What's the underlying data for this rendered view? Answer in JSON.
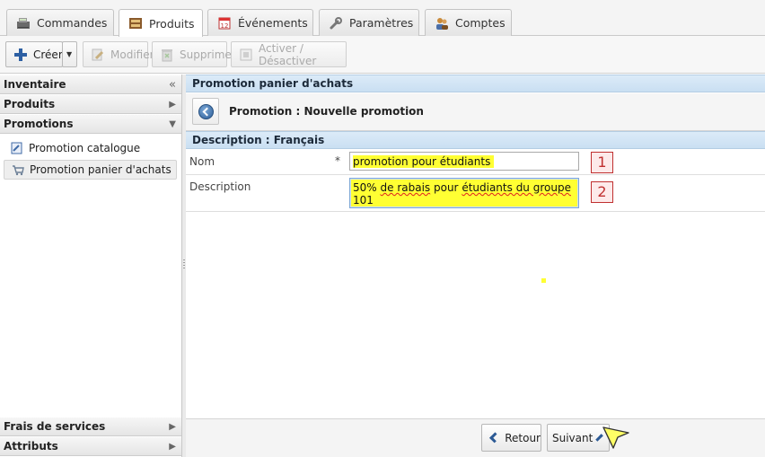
{
  "tabs": [
    {
      "label": "Commandes",
      "icon": "register-icon",
      "active": false
    },
    {
      "label": "Produits",
      "icon": "products-box-icon",
      "active": true
    },
    {
      "label": "Événements",
      "icon": "calendar-icon",
      "active": false
    },
    {
      "label": "Paramètres",
      "icon": "wrench-icon",
      "active": false
    },
    {
      "label": "Comptes",
      "icon": "users-icon",
      "active": false
    }
  ],
  "toolbar": {
    "create_label": "Créer",
    "edit_label": "Modifier",
    "delete_label": "Supprimer",
    "toggle_label": "Activer / Désactiver"
  },
  "sidebar": {
    "sections": [
      {
        "label": "Inventaire",
        "arrow": "«"
      },
      {
        "label": "Produits",
        "arrow": "▶"
      },
      {
        "label": "Promotions",
        "arrow": "▼"
      }
    ],
    "items": [
      {
        "label": "Promotion catalogue",
        "icon": "catalogue-promo-icon",
        "selected": false
      },
      {
        "label": "Promotion panier d'achats",
        "icon": "cart-promo-icon",
        "selected": true
      }
    ],
    "bottom_sections": [
      {
        "label": "Frais de services",
        "arrow": "▶"
      },
      {
        "label": "Attributs",
        "arrow": "▶"
      }
    ]
  },
  "main": {
    "panel_title": "Promotion panier d'achats",
    "header_title": "Promotion : Nouvelle promotion",
    "section_title": "Description : Français",
    "form": {
      "name_label": "Nom",
      "required_mark": "*",
      "name_value": "promotion pour étudiants",
      "description_label": "Description",
      "description_value_prefix": "50% ",
      "description_value_mark1": "de rabais",
      "description_value_space1": " pour ",
      "description_value_mark2": "étudiants du groupe",
      "description_value_suffix": " 101"
    },
    "annotations": [
      "1",
      "2"
    ],
    "footer": {
      "back_label": "Retour",
      "next_label": "Suivant"
    }
  },
  "colors": {
    "highlight": "#ffff33",
    "panel_header": "#c9dff2",
    "badge": "#c03030",
    "nav_chevron": "#2c5a95"
  }
}
